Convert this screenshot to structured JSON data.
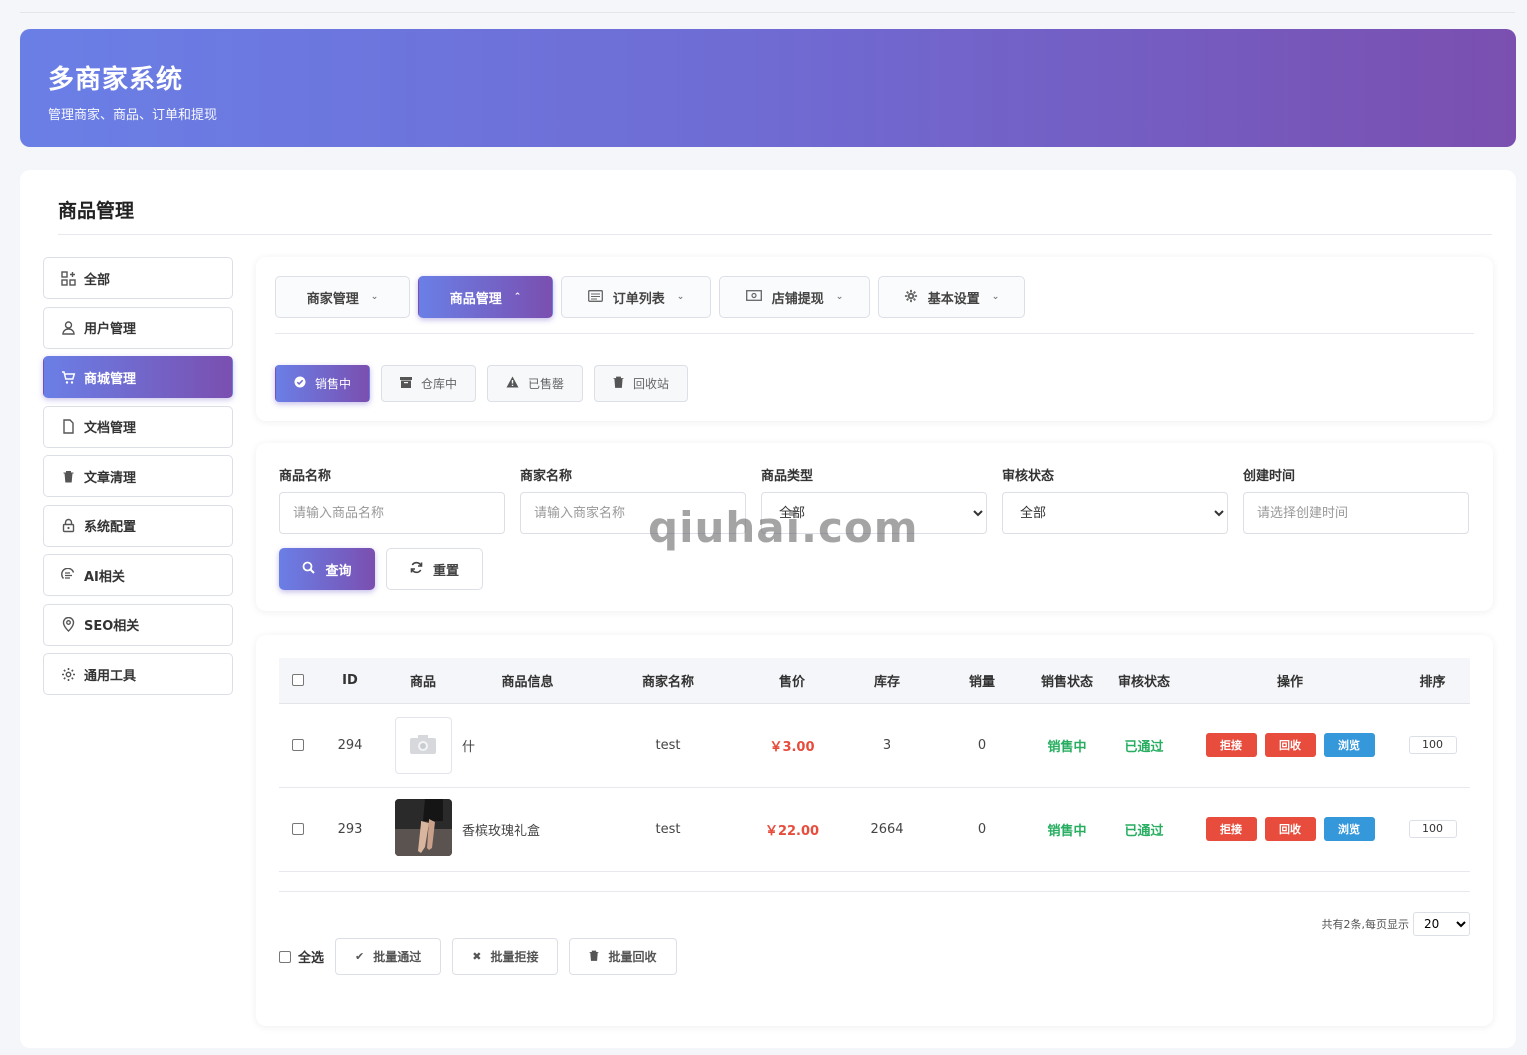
{
  "header": {
    "title": "多商家系统",
    "subtitle": "管理商家、商品、订单和提现"
  },
  "card": {
    "title": "商品管理"
  },
  "sidebar": {
    "items": [
      {
        "label": "全部",
        "icon": "grid-icon"
      },
      {
        "label": "用户管理",
        "icon": "user-icon"
      },
      {
        "label": "商城管理",
        "icon": "cart-icon",
        "active": true
      },
      {
        "label": "文档管理",
        "icon": "file-icon"
      },
      {
        "label": "文章清理",
        "icon": "trash-icon"
      },
      {
        "label": "系统配置",
        "icon": "lock-icon"
      },
      {
        "label": "AI相关",
        "icon": "ai-icon"
      },
      {
        "label": "SEO相关",
        "icon": "location-icon"
      },
      {
        "label": "通用工具",
        "icon": "gear-icon"
      }
    ]
  },
  "tabs": [
    {
      "label": "商家管理"
    },
    {
      "label": "商品管理",
      "active": true
    },
    {
      "label": "订单列表"
    },
    {
      "label": "店铺提现"
    },
    {
      "label": "基本设置"
    }
  ],
  "subtabs": [
    {
      "label": "销售中",
      "active": true
    },
    {
      "label": "仓库中"
    },
    {
      "label": "已售罄"
    },
    {
      "label": "回收站"
    }
  ],
  "filters": {
    "name": {
      "label": "商品名称",
      "placeholder": "请输入商品名称"
    },
    "merchant": {
      "label": "商家名称",
      "placeholder": "请输入商家名称"
    },
    "type": {
      "label": "商品类型",
      "value": "全部"
    },
    "audit": {
      "label": "审核状态",
      "value": "全部"
    },
    "created": {
      "label": "创建时间",
      "placeholder": "请选择创建时间"
    },
    "query_label": "查询",
    "reset_label": "重置"
  },
  "table": {
    "headers": [
      "ID",
      "商品",
      "商品信息",
      "商家名称",
      "售价",
      "库存",
      "销量",
      "销售状态",
      "审核状态",
      "操作",
      "排序"
    ],
    "rows": [
      {
        "id": "294",
        "info": "什",
        "merchant": "test",
        "price": "￥3.00",
        "stock": "3",
        "sales": "0",
        "sale_status": "销售中",
        "audit_status": "已通过",
        "sort": "100",
        "image": "placeholder"
      },
      {
        "id": "293",
        "info": "香槟玫瑰礼盒",
        "merchant": "test",
        "price": "￥22.00",
        "stock": "2664",
        "sales": "0",
        "sale_status": "销售中",
        "audit_status": "已通过",
        "sort": "100",
        "image": "photo"
      }
    ],
    "actions": {
      "reject": "拒接",
      "recycle": "回收",
      "view": "浏览"
    }
  },
  "pager": {
    "summary": "共有2条,每页显示",
    "page_size": "20"
  },
  "bulk": {
    "select_all": "全选",
    "approve": "批量通过",
    "reject": "批量拒接",
    "recycle": "批量回收"
  },
  "watermark": "qiuhai.com",
  "colors": {
    "accent_start": "#6a7fe6",
    "accent_end": "#7a4fb0",
    "price": "#e74c3c",
    "ok": "#27ae60",
    "view": "#3498db"
  }
}
